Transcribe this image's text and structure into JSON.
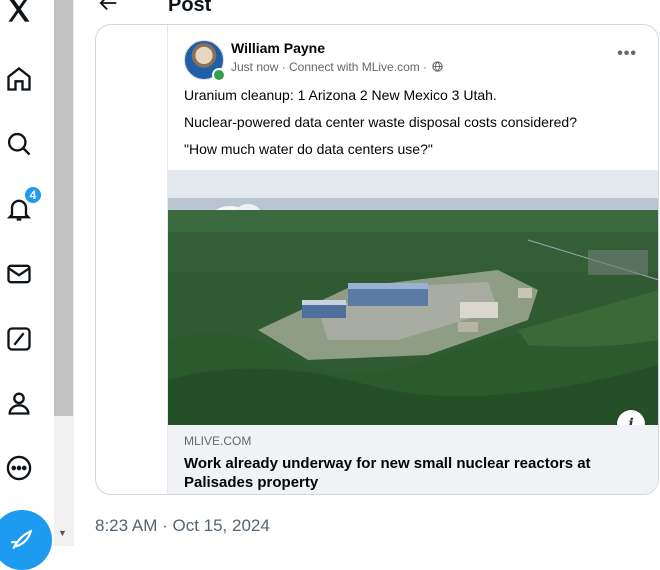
{
  "nav": {
    "notification_count": "4",
    "items": [
      "x-logo",
      "home",
      "explore",
      "notifications",
      "messages",
      "grok",
      "profile",
      "more"
    ]
  },
  "header": {
    "title": "Post"
  },
  "embed": {
    "author": "William Payne",
    "meta": "Just now · Connect with MLive.com ·",
    "lines": [
      "Uranium cleanup:  1 Arizona 2 New Mexico 3 Utah.",
      "Nuclear-powered data center waste disposal costs considered?",
      "\"How much water do data centers use?\""
    ],
    "link_domain": "MLIVE.COM",
    "link_title": "Work already underway for new small nuclear reactors at Palisades property",
    "info_label": "i",
    "more_label": "•••"
  },
  "timestamp": "8:23 AM · Oct 15, 2024",
  "colors": {
    "accent": "#1d9bf0",
    "text": "#0f1419",
    "muted": "#536471"
  }
}
